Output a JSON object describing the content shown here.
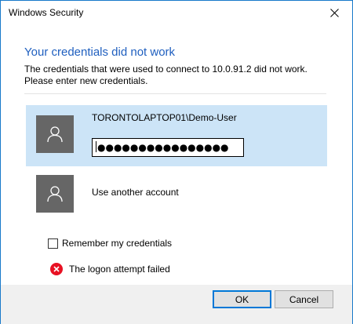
{
  "window": {
    "title": "Windows Security"
  },
  "dialog": {
    "heading": "Your credentials did not work",
    "description": "The credentials that were used to connect to 10.0.91.2 did not work. Please enter new credentials."
  },
  "accounts": {
    "selected": {
      "username": "TORONTOLAPTOP01\\Demo-User",
      "password_masked": "●●●●●●●●●●●●●●●●"
    },
    "other": {
      "label": "Use another account"
    }
  },
  "remember": {
    "label": "Remember my credentials",
    "checked": false
  },
  "error": {
    "message": "The logon attempt failed"
  },
  "buttons": {
    "ok_label": "OK",
    "cancel_label": "Cancel"
  },
  "colors": {
    "accent": "#1979ca",
    "selected_bg": "#cce4f7",
    "heading": "#1f5fbf",
    "error": "#e81123",
    "avatar_bg": "#666666"
  },
  "icons": {
    "close": "close-icon",
    "avatar": "user-icon",
    "error": "error-icon"
  }
}
